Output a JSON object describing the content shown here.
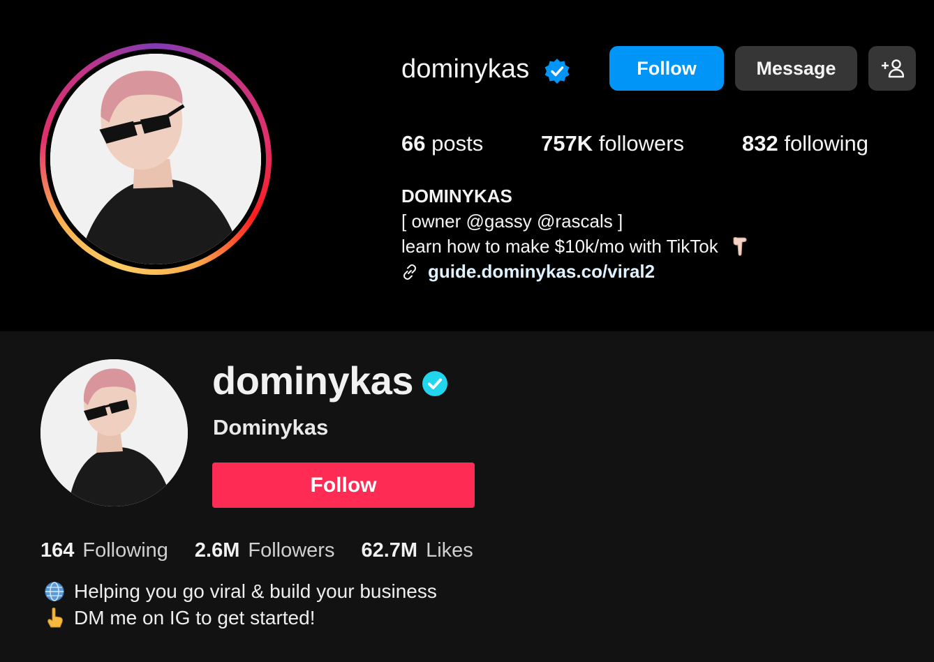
{
  "instagram": {
    "username": "dominykas",
    "buttons": {
      "follow": "Follow",
      "message": "Message",
      "add_user_icon": "add-person-icon"
    },
    "stats": {
      "posts_count": "66",
      "posts_label": "posts",
      "followers_count": "757K",
      "followers_label": "followers",
      "following_count": "832",
      "following_label": "following"
    },
    "bio": {
      "name": "DOMINYKAS",
      "line1": "[ owner @gassy @rascals ]",
      "line2": "learn how to make $10k/mo with TikTok",
      "line2_emoji": "pointing-down-hand-emoji",
      "link": "guide.dominykas.co/viral2",
      "link_icon": "link-icon"
    },
    "colors": {
      "follow_button": "#0095f6",
      "secondary_button": "#363636",
      "verified": "#0095f6"
    }
  },
  "tiktok": {
    "username": "dominykas",
    "nickname": "Dominykas",
    "follow_button": "Follow",
    "stats": {
      "following_count": "164",
      "following_label": "Following",
      "followers_count": "2.6M",
      "followers_label": "Followers",
      "likes_count": "62.7M",
      "likes_label": "Likes"
    },
    "bio": {
      "line1": "Helping you go viral & build your business",
      "line1_icon": "globe-icon",
      "line2": "DM me on IG to get started!",
      "line2_icon": "pointing-up-hand-emoji"
    },
    "colors": {
      "follow_button": "#fe2c55",
      "verified": "#20d5ec",
      "background": "#121212"
    }
  }
}
